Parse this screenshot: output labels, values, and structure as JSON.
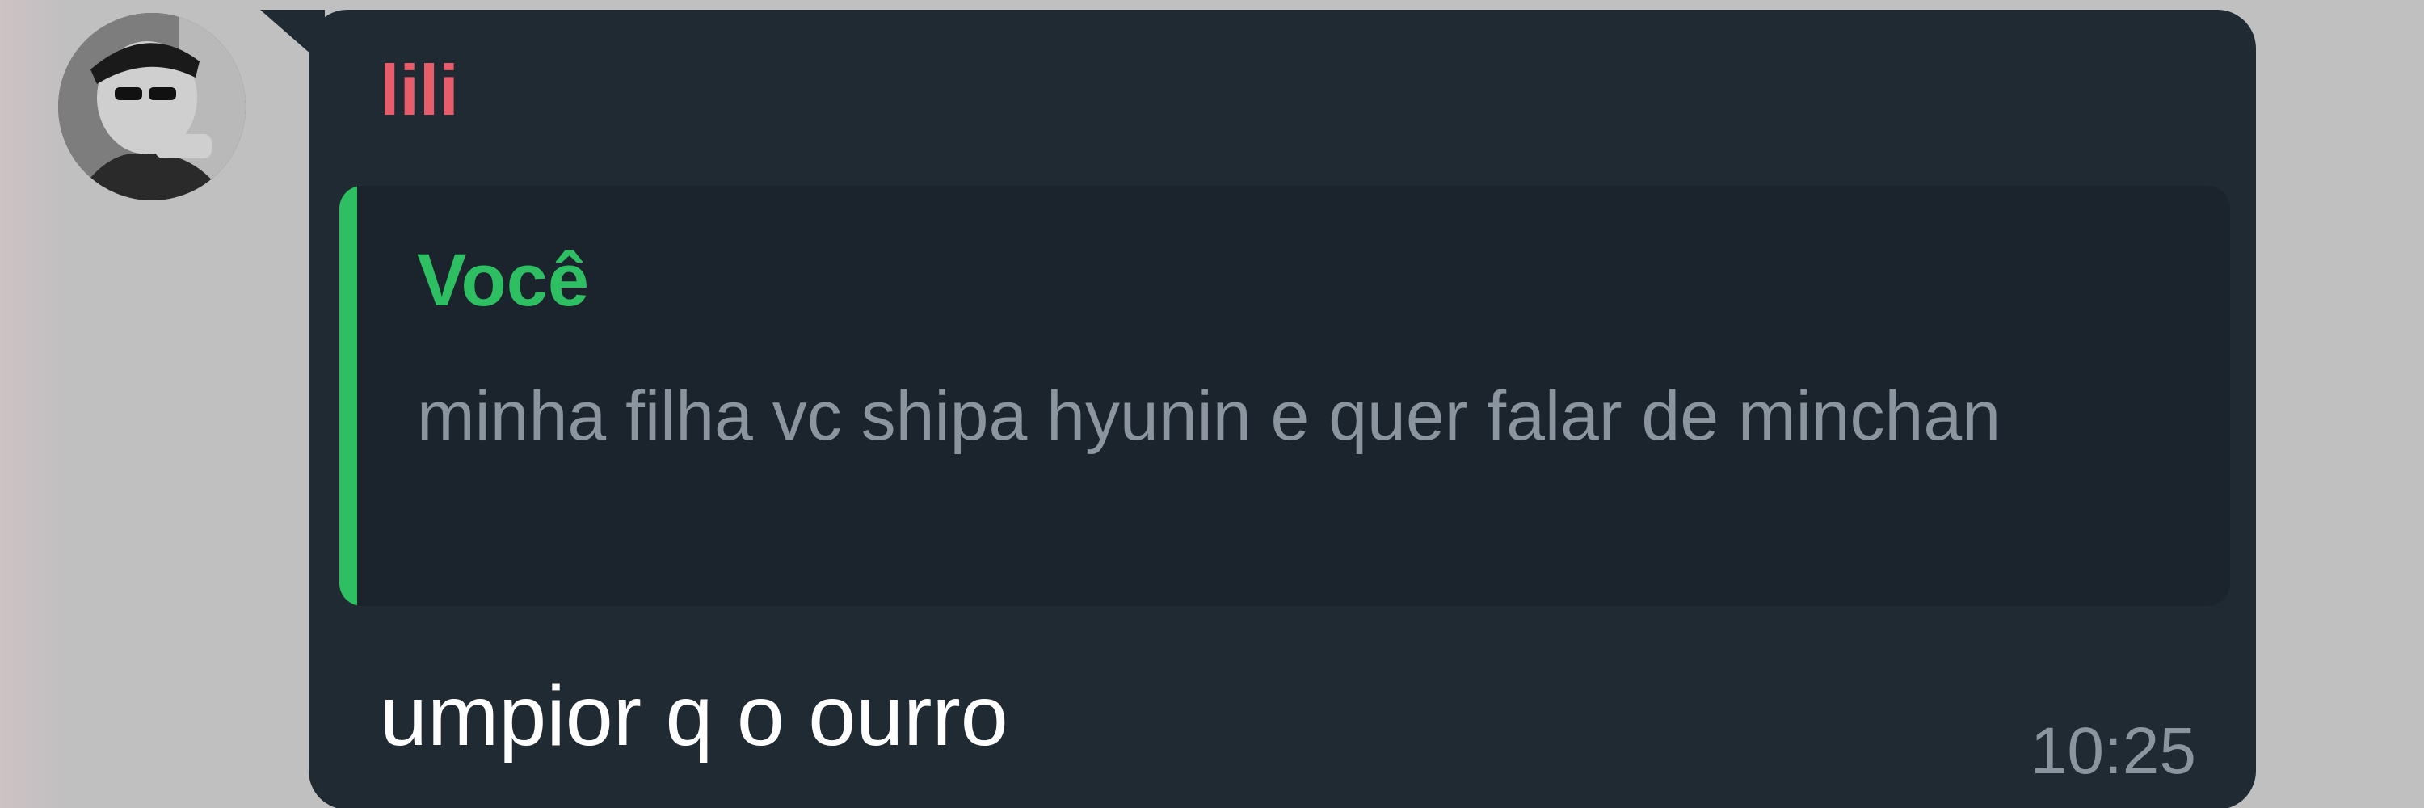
{
  "message": {
    "sender": "lili",
    "quoted_reply": {
      "author": "Você",
      "text": "minha filha vc shipa hyunin e quer falar de minchan"
    },
    "text": "umpior q o ourro",
    "time": "10:25"
  },
  "colors": {
    "background": "#c0c0c0",
    "bubble": "#1f2a33",
    "quote_background": "#1b242d",
    "sender_name": "#e85d6b",
    "quote_accent": "#2fbf63",
    "secondary_text": "#8a95a0",
    "message_text": "#ffffff"
  },
  "icons": {
    "avatar": "profile-photo-avatar"
  }
}
